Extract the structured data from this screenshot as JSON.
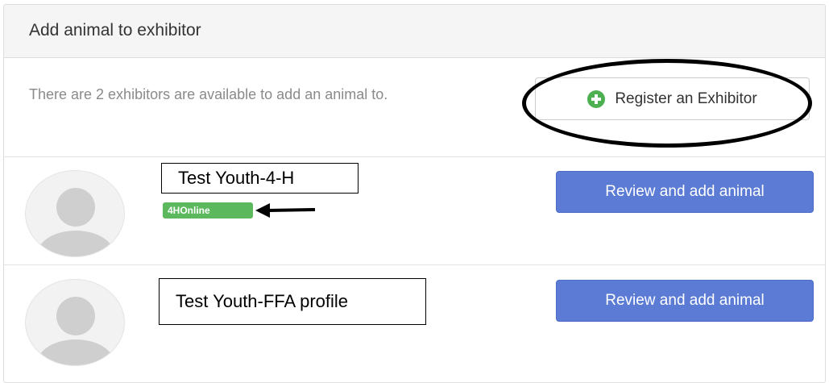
{
  "panel": {
    "title": "Add animal to exhibitor",
    "intro": "There are 2 exhibitors are available to add an animal to.",
    "register_button": {
      "label": "Register an Exhibitor",
      "icon": "plus-circle-icon",
      "icon_color": "#4caf50"
    }
  },
  "exhibitors": [
    {
      "name": "Test Youth-4-H",
      "badge": "4HOnline",
      "badge_color": "#5cb85c",
      "action_label": "Review and add animal"
    },
    {
      "name": "Test Youth-FFA profile",
      "action_label": "Review and add animal"
    }
  ],
  "colors": {
    "primary_button": "#5b7bd5",
    "heading_bg": "#f5f5f5"
  }
}
